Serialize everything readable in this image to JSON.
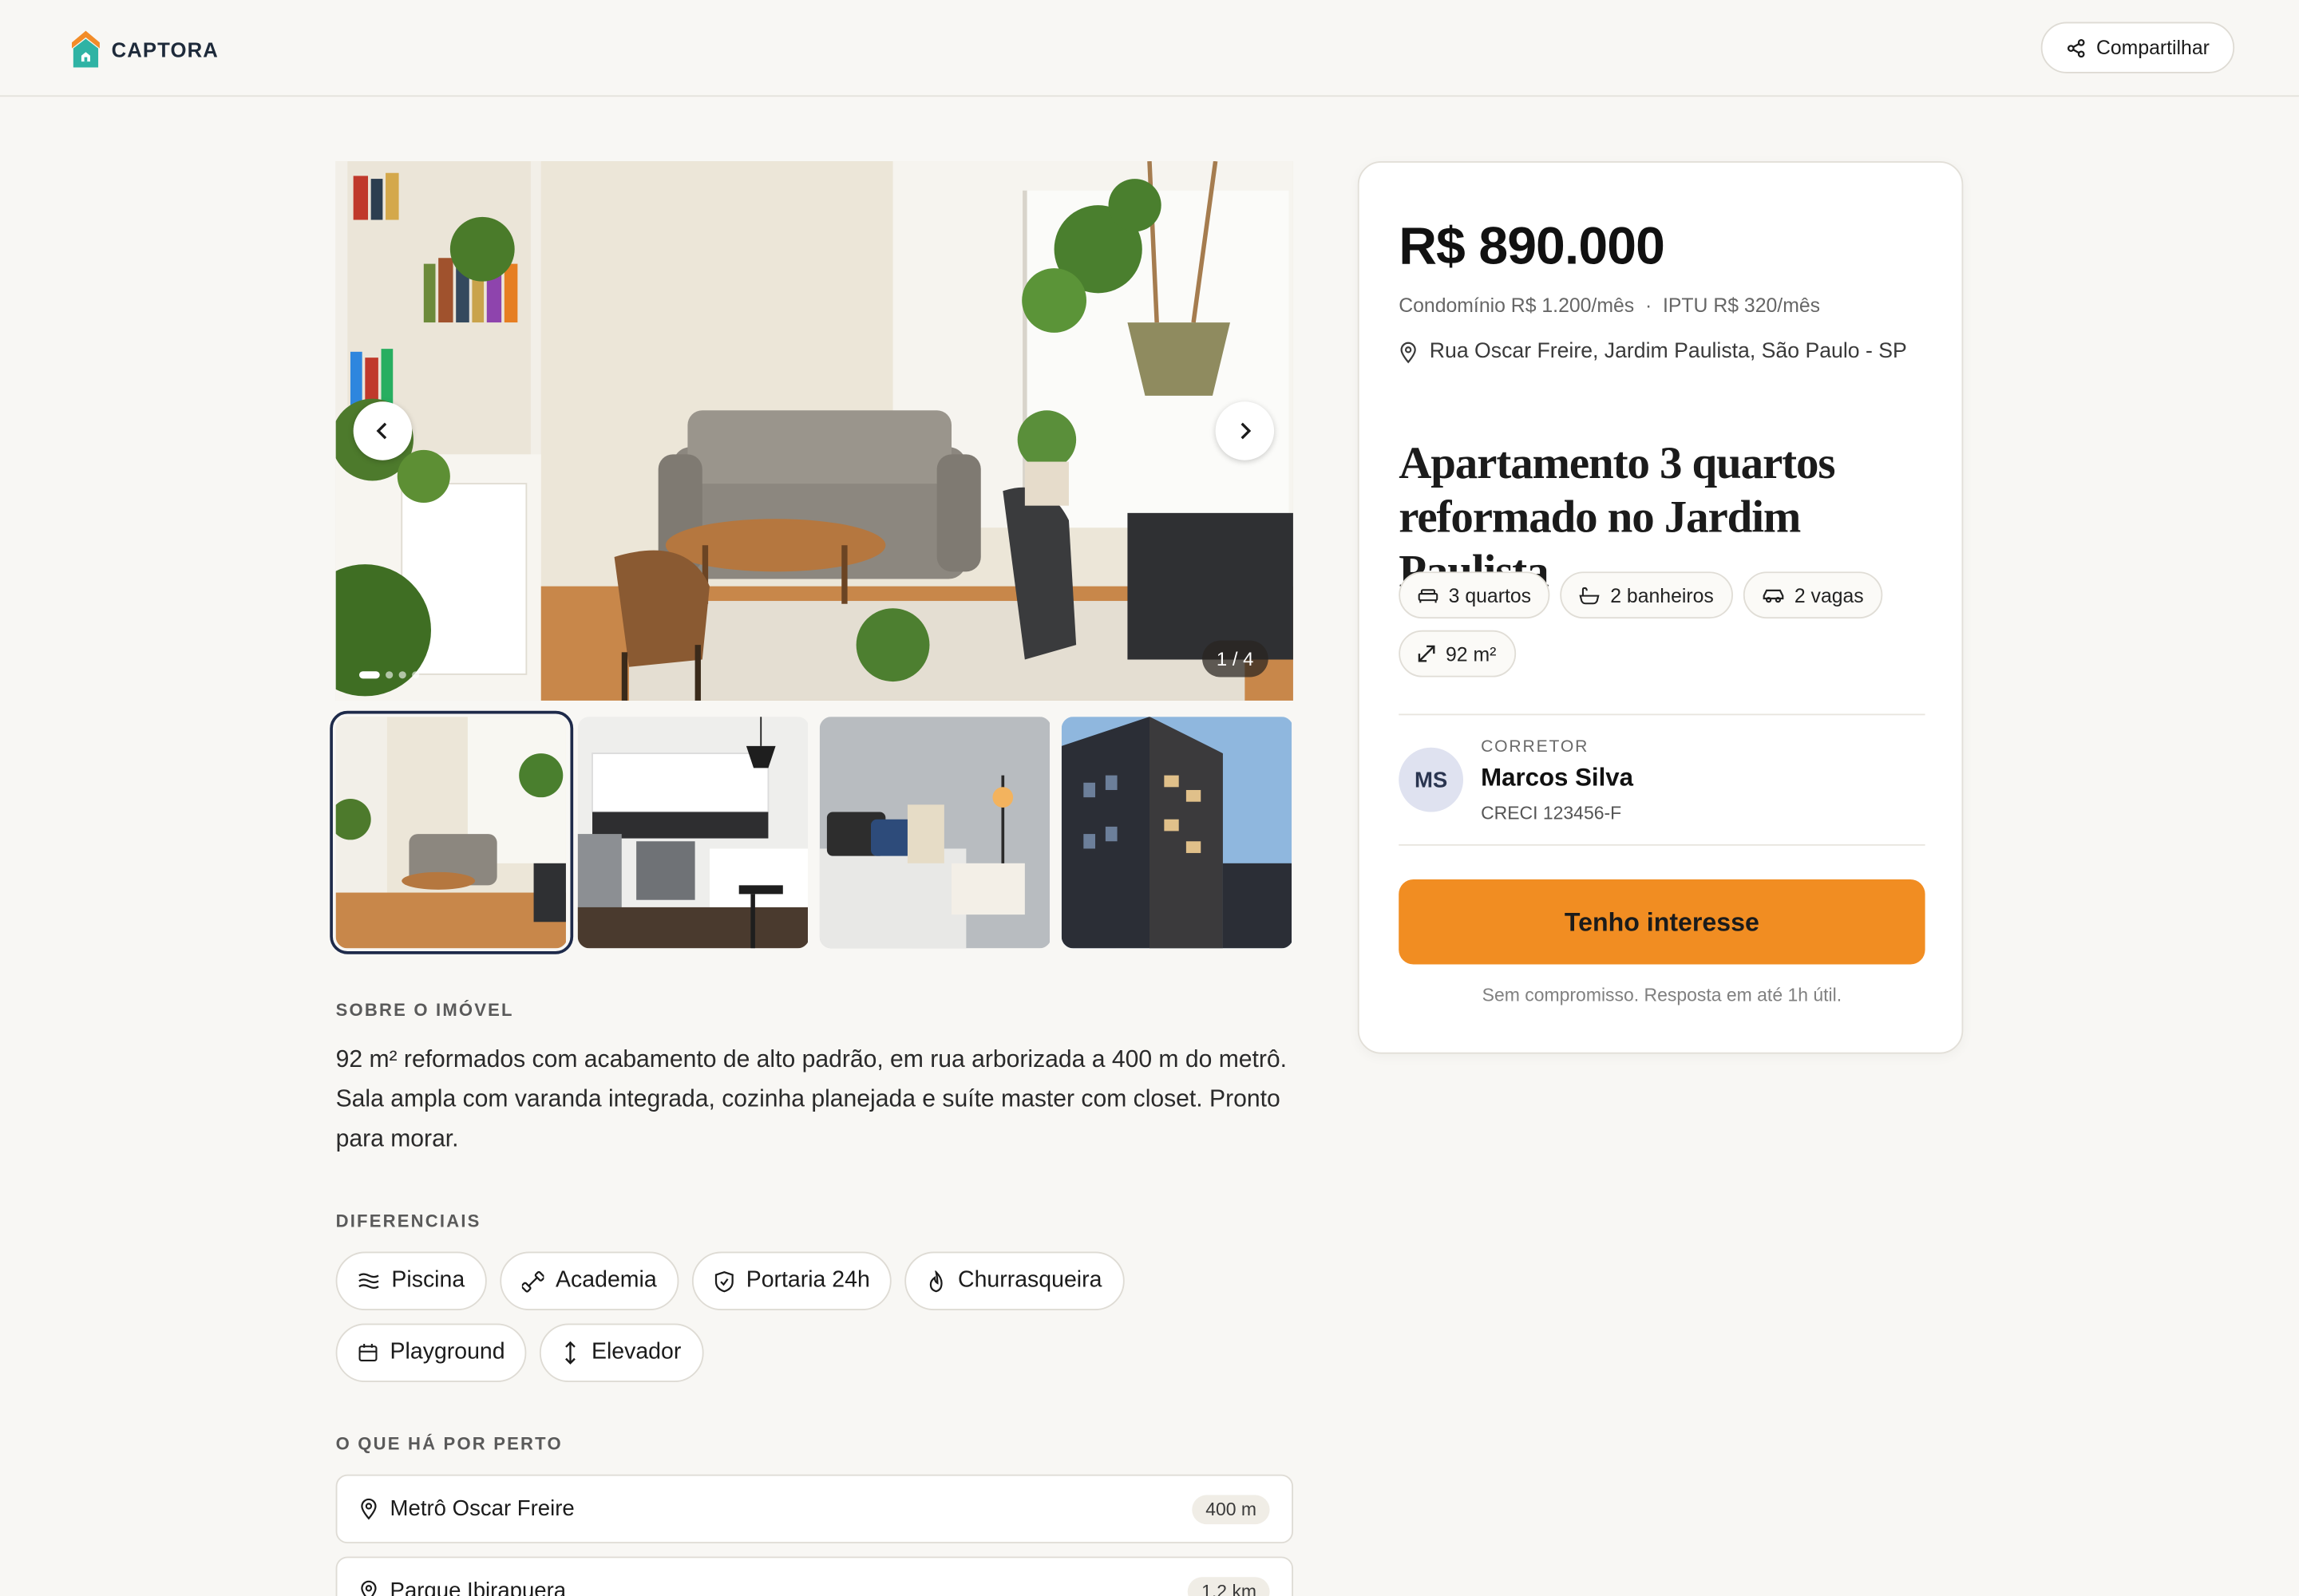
{
  "header": {
    "brand": "CAPTORA",
    "share_label": "Compartilhar"
  },
  "gallery": {
    "counter": "1 / 4",
    "current_index": 1,
    "total": 4
  },
  "listing": {
    "price": "R$ 890.000",
    "fees": "Condomínio R$ 1.200/mês  ·  IPTU R$ 320/mês",
    "address": "Rua Oscar Freire, Jardim Paulista, São Paulo - SP",
    "title": "Apartamento 3 quartos reformado no Jardim Paulista",
    "specs": [
      {
        "icon": "bed-icon",
        "label": "3 quartos"
      },
      {
        "icon": "bath-icon",
        "label": "2 banheiros"
      },
      {
        "icon": "car-icon",
        "label": "2 vagas"
      },
      {
        "icon": "area-icon",
        "label": "92 m²"
      }
    ]
  },
  "broker": {
    "initials": "MS",
    "role": "CORRETOR",
    "name": "Marcos Silva",
    "creci": "CRECI 123456-F"
  },
  "cta": {
    "label": "Tenho interesse",
    "note": "Sem compromisso. Resposta em até 1h útil."
  },
  "about": {
    "heading": "SOBRE O IMÓVEL",
    "text": "92 m² reformados com acabamento de alto padrão, em rua arborizada a 400 m do metrô. Sala ampla com varanda integrada, cozinha planejada e suíte master com closet. Pronto para morar."
  },
  "amenities": {
    "heading": "DIFERENCIAIS",
    "items": [
      {
        "icon": "wave-icon",
        "label": "Piscina"
      },
      {
        "icon": "dumbbell-icon",
        "label": "Academia"
      },
      {
        "icon": "shield-icon",
        "label": "Portaria 24h"
      },
      {
        "icon": "flame-icon",
        "label": "Churrasqueira"
      },
      {
        "icon": "calendar-icon",
        "label": "Playground"
      },
      {
        "icon": "updown-arrow-icon",
        "label": "Elevador"
      }
    ]
  },
  "nearby": {
    "heading": "O QUE HÁ POR PERTO",
    "items": [
      {
        "name": "Metrô Oscar Freire",
        "distance": "400 m"
      },
      {
        "name": "Parque Ibirapuera",
        "distance": "1,2 km"
      }
    ]
  },
  "colors": {
    "accent": "#f18d22",
    "brand_navy": "#1e2a3a",
    "background": "#f8f7f4"
  }
}
